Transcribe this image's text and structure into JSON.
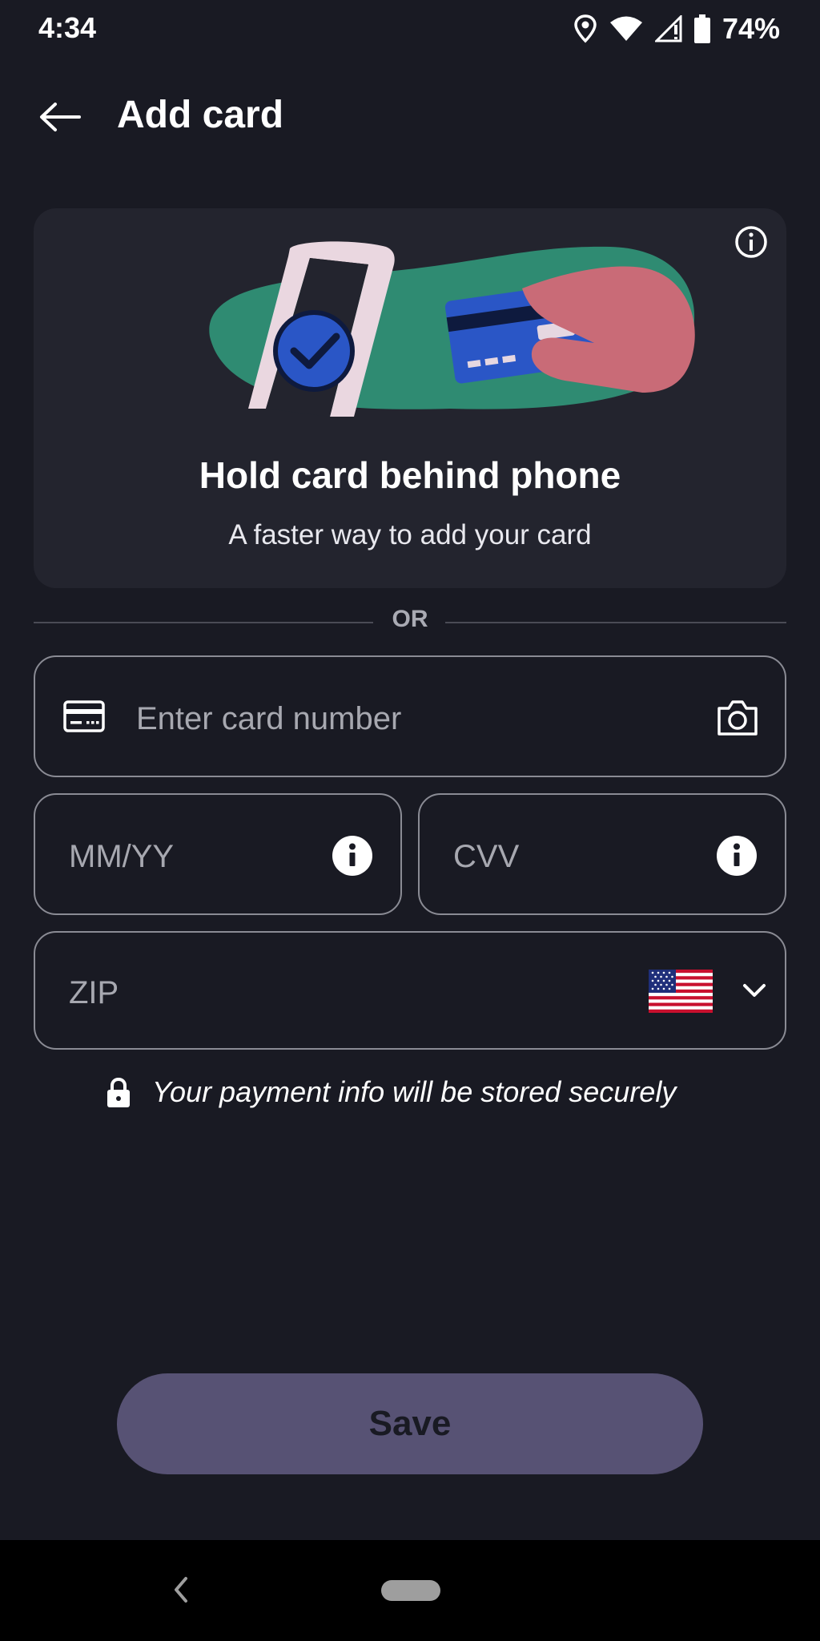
{
  "status_bar": {
    "time": "4:34",
    "battery_percent": "74%",
    "icons": [
      "location-icon",
      "wifi-icon",
      "signal-icon",
      "battery-icon"
    ]
  },
  "header": {
    "title": "Add card",
    "back_icon": "back-arrow-icon"
  },
  "scan_card": {
    "title": "Hold card behind phone",
    "subtitle": "A faster way to add your card",
    "info_icon": "info-icon"
  },
  "divider": {
    "label": "OR"
  },
  "form": {
    "card_number": {
      "value": "",
      "placeholder": "Enter card number",
      "icon": "credit-card-icon",
      "action_icon": "camera-icon"
    },
    "expiry": {
      "value": "",
      "placeholder": "MM/YY",
      "icon": "info-icon"
    },
    "cvv": {
      "value": "",
      "placeholder": "CVV",
      "icon": "info-icon"
    },
    "zip": {
      "value": "",
      "placeholder": "ZIP",
      "country_flag": "us-flag-icon",
      "dropdown_icon": "chevron-down-icon"
    }
  },
  "secure_note": {
    "text": "Your payment info will be stored securely",
    "icon": "lock-icon"
  },
  "save_button": {
    "label": "Save"
  },
  "colors": {
    "background": "#191a23",
    "card_surface": "#23242e",
    "field_border": "#8a8b94",
    "save_button": "#575274",
    "illustration_green": "#2f8b72",
    "illustration_card_blue": "#2a56c6",
    "illustration_hand": "#c96b77"
  }
}
